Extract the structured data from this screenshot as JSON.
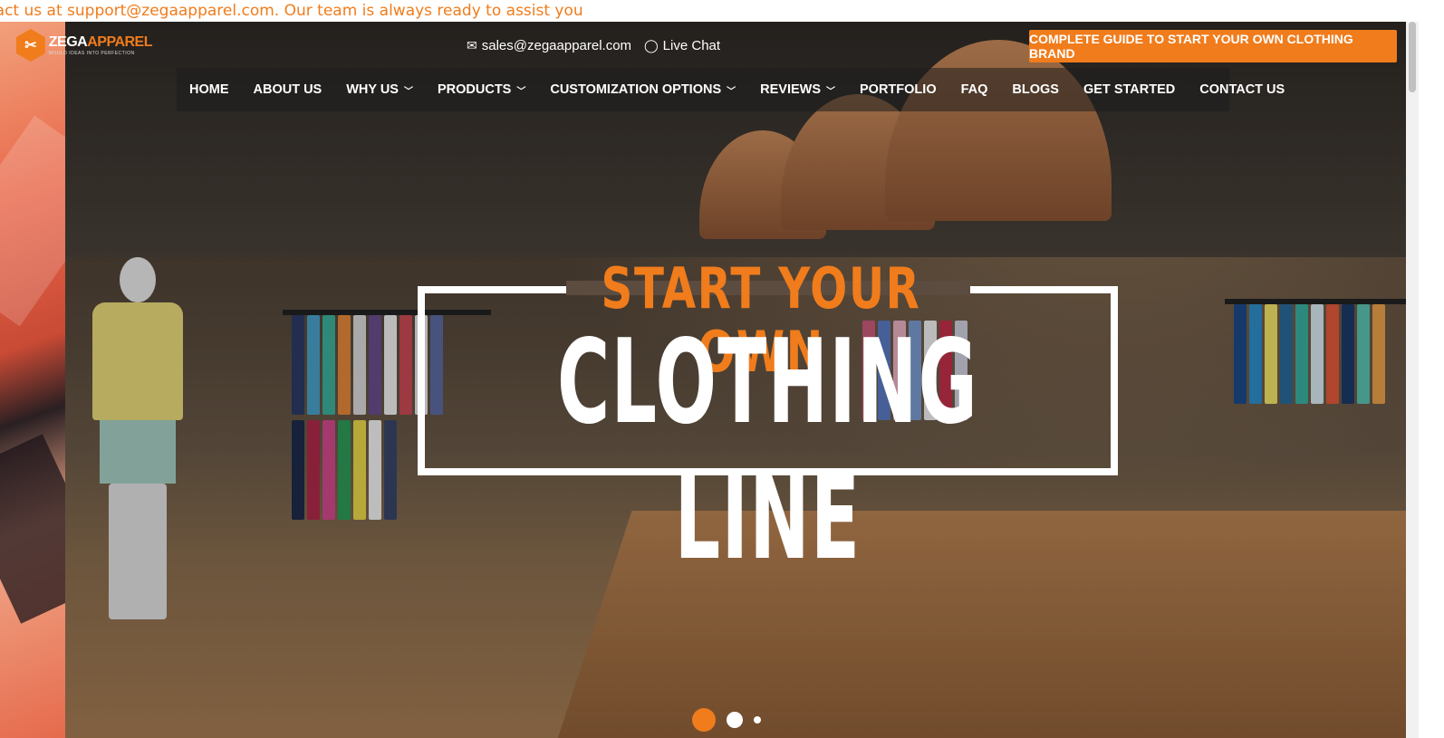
{
  "ticker": {
    "text": "tact us at support@zegaapparel.com. Our team is always ready to assist you"
  },
  "logo": {
    "name_a": "ZEGA",
    "name_b": "APPAREL",
    "tagline": "MOULD IDEAS INTO PERFECTION",
    "icon": "zega-hex-logo"
  },
  "contact": {
    "email": {
      "icon": "envelope-icon",
      "label": "sales@zegaapparel.com"
    },
    "chat": {
      "icon": "chat-bubble-icon",
      "label": "Live Chat"
    }
  },
  "cta": {
    "label": "COMPLETE GUIDE TO START YOUR OWN CLOTHING BRAND"
  },
  "nav": {
    "items": [
      {
        "label": "HOME",
        "dropdown": false
      },
      {
        "label": "ABOUT US",
        "dropdown": false
      },
      {
        "label": "WHY US",
        "dropdown": true
      },
      {
        "label": "PRODUCTS",
        "dropdown": true
      },
      {
        "label": "CUSTOMIZATION OPTIONS",
        "dropdown": true
      },
      {
        "label": "REVIEWS",
        "dropdown": true
      },
      {
        "label": "PORTFOLIO",
        "dropdown": false
      },
      {
        "label": "FAQ",
        "dropdown": false
      },
      {
        "label": "BLOGS",
        "dropdown": false
      },
      {
        "label": "GET STARTED",
        "dropdown": false
      },
      {
        "label": "CONTACT US",
        "dropdown": false
      }
    ]
  },
  "hero": {
    "headline_top": "START YOUR OWN",
    "headline_main": "CLOTHING LINE"
  },
  "slider": {
    "count": 3,
    "active": 1
  },
  "colors": {
    "accent": "#f07c1c",
    "white": "#ffffff"
  }
}
